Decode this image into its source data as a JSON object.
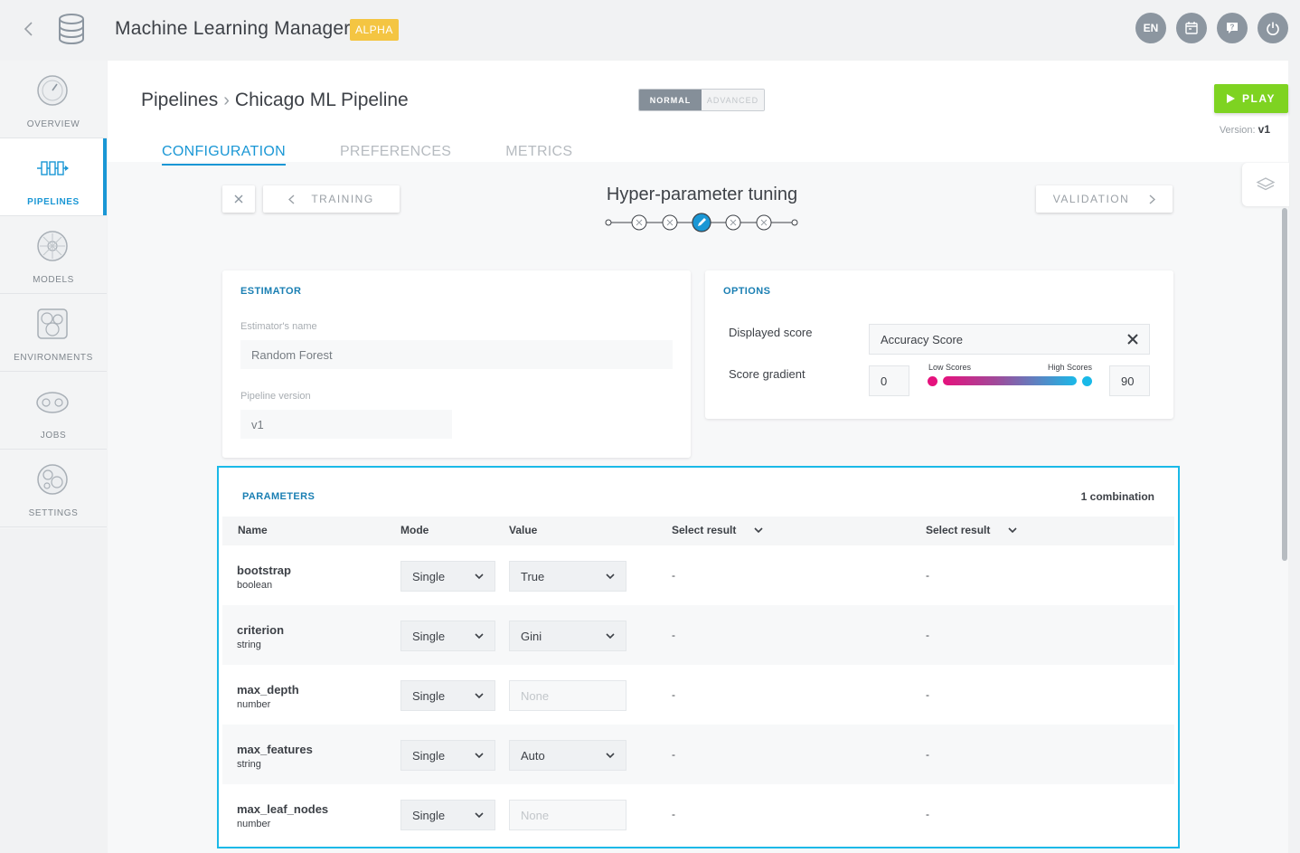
{
  "app": {
    "title": "Machine Learning Manager",
    "badge": "ALPHA"
  },
  "top_icons": {
    "lang": "EN"
  },
  "sidebar": {
    "items": [
      {
        "label": "OVERVIEW",
        "icon": "gauge-icon"
      },
      {
        "label": "PIPELINES",
        "icon": "pipeline-icon"
      },
      {
        "label": "MODELS",
        "icon": "model-icon"
      },
      {
        "label": "ENVIRONMENTS",
        "icon": "environment-icon"
      },
      {
        "label": "JOBS",
        "icon": "gears-icon"
      },
      {
        "label": "SETTINGS",
        "icon": "settings-icon"
      }
    ]
  },
  "breadcrumb": {
    "root": "Pipelines",
    "current": "Chicago ML Pipeline"
  },
  "mode": {
    "normal": "NORMAL",
    "advanced": "ADVANCED"
  },
  "play": {
    "label": "PLAY"
  },
  "version": {
    "label": "Version:",
    "value": "v1"
  },
  "tabs": [
    "CONFIGURATION",
    "PREFERENCES",
    "METRICS"
  ],
  "step": {
    "prev": "TRAINING",
    "title": "Hyper-parameter tuning",
    "next": "VALIDATION"
  },
  "estimator": {
    "title": "ESTIMATOR",
    "name_label": "Estimator's name",
    "name_value": "Random Forest",
    "version_label": "Pipeline version",
    "version_value": "v1"
  },
  "options": {
    "title": "OPTIONS",
    "displayed_score_label": "Displayed score",
    "displayed_score_value": "Accuracy Score",
    "gradient_label": "Score gradient",
    "gradient_min": "0",
    "gradient_max": "90",
    "low_label": "Low Scores",
    "high_label": "High Scores",
    "low_color": "#e5127d",
    "high_color": "#1ab9e8"
  },
  "parameters": {
    "title": "PARAMETERS",
    "combinations": "1 combination",
    "columns": {
      "name": "Name",
      "mode": "Mode",
      "value": "Value",
      "result1": "Select result",
      "result2": "Select result"
    },
    "rows": [
      {
        "name": "bootstrap",
        "type": "boolean",
        "mode": "Single",
        "value": "True",
        "r1": "-",
        "r2": "-"
      },
      {
        "name": "criterion",
        "type": "string",
        "mode": "Single",
        "value": "Gini",
        "r1": "-",
        "r2": "-"
      },
      {
        "name": "max_depth",
        "type": "number",
        "mode": "Single",
        "value": "None",
        "r1": "-",
        "r2": "-"
      },
      {
        "name": "max_features",
        "type": "string",
        "mode": "Single",
        "value": "Auto",
        "r1": "-",
        "r2": "-"
      },
      {
        "name": "max_leaf_nodes",
        "type": "number",
        "mode": "Single",
        "value": "None",
        "r1": "-",
        "r2": "-"
      }
    ]
  }
}
